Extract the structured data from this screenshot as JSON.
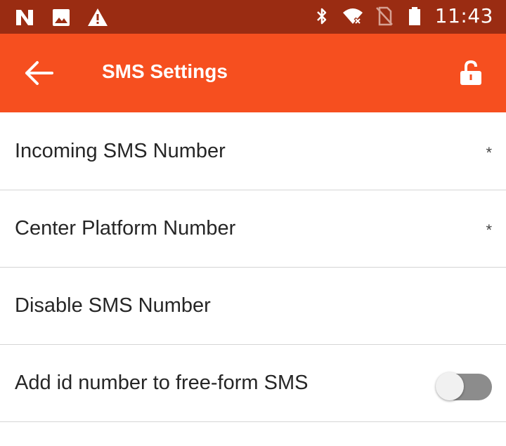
{
  "status_bar": {
    "time": "11:43",
    "left_icons": [
      "n-logo-icon",
      "image-icon",
      "warning-icon"
    ],
    "right_icons": [
      "bluetooth-icon",
      "wifi-icon",
      "no-sim-icon",
      "battery-icon"
    ]
  },
  "app_bar": {
    "title": "SMS Settings",
    "back_icon": "arrow-left-icon",
    "action_icon": "unlock-icon",
    "background_color": "#f64f1f"
  },
  "settings": [
    {
      "label": "Incoming SMS Number",
      "required_mark": "*"
    },
    {
      "label": "Center Platform Number",
      "required_mark": "*"
    },
    {
      "label": "Disable SMS Number",
      "required_mark": ""
    },
    {
      "label": "Add id number to free-form SMS",
      "toggle": "off"
    }
  ],
  "colors": {
    "status_bar": "#9a2c12",
    "accent": "#f64f1f",
    "divider": "#d5d5d5",
    "text": "#262626"
  }
}
